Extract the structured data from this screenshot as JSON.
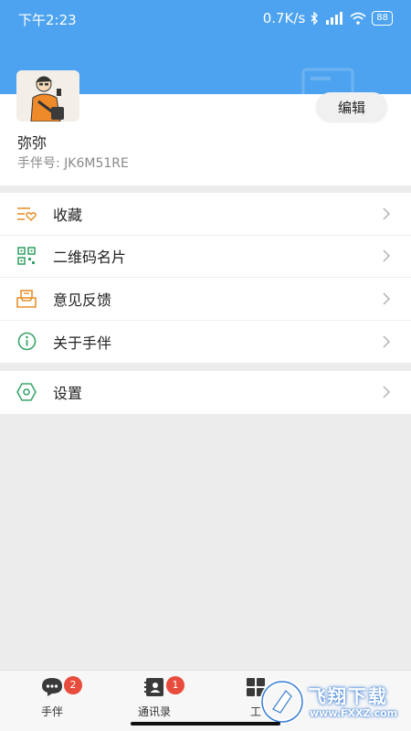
{
  "status_bar": {
    "time": "下午2:23",
    "network_speed": "0.7K/s",
    "battery": "88"
  },
  "profile": {
    "name": "弥弥",
    "id_text": "手伴号: JK6M51RE",
    "edit_label": "编辑"
  },
  "menu": {
    "group1": [
      {
        "label": "收藏",
        "icon": "favorites-icon"
      },
      {
        "label": "二维码名片",
        "icon": "qr-code-icon"
      },
      {
        "label": "意见反馈",
        "icon": "feedback-icon"
      },
      {
        "label": "关于手伴",
        "icon": "info-icon"
      }
    ],
    "group2": [
      {
        "label": "设置",
        "icon": "settings-icon"
      }
    ]
  },
  "tabs": [
    {
      "label": "手伴",
      "badge": "2",
      "icon": "chat-icon"
    },
    {
      "label": "通讯录",
      "badge": "1",
      "icon": "contacts-icon"
    },
    {
      "label": "工",
      "icon": "apps-icon"
    }
  ],
  "watermark": {
    "text": "飞翔下载",
    "url": "www.FXXZ.com"
  },
  "colors": {
    "header": "#4da3ef",
    "icon_orange": "#e8912d",
    "icon_green": "#3aa56a",
    "badge": "#e74c3c"
  }
}
